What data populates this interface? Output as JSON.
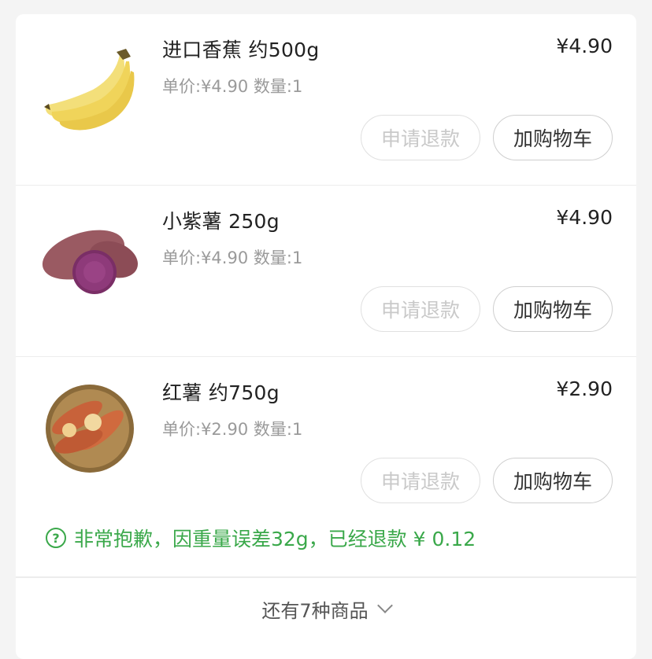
{
  "items": [
    {
      "name": "进口香蕉 约500g",
      "price": "¥4.90",
      "meta": "单价:¥4.90 数量:1",
      "refund_label": "申请退款",
      "cart_label": "加购物车",
      "image": "banana-image"
    },
    {
      "name": "小紫薯 250g",
      "price": "¥4.90",
      "meta": "单价:¥4.90 数量:1",
      "refund_label": "申请退款",
      "cart_label": "加购物车",
      "image": "purple-sweet-potato-image"
    },
    {
      "name": "红薯 约750g",
      "price": "¥2.90",
      "meta": "单价:¥2.90 数量:1",
      "refund_label": "申请退款",
      "cart_label": "加购物车",
      "image": "red-sweet-potato-image",
      "notice": "非常抱歉，因重量误差32g，已经退款 ¥ 0.12"
    }
  ],
  "notice_icon": "question-circle-icon",
  "more": {
    "label": "还有7种商品",
    "icon": "chevron-down-icon"
  },
  "colors": {
    "accent_green": "#3aa84a",
    "disabled_text": "#c9c9c9",
    "price_text": "#222222",
    "meta_text": "#9a9a9a"
  }
}
